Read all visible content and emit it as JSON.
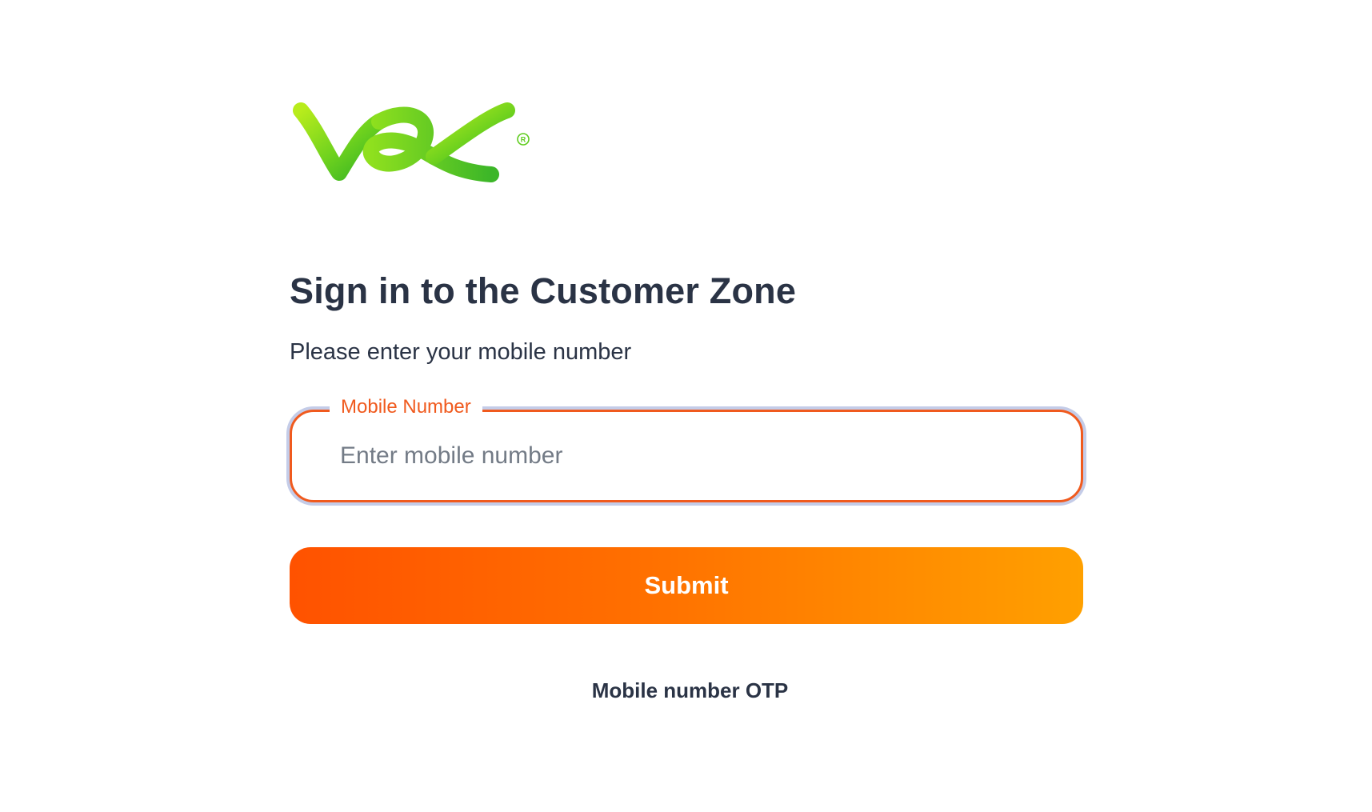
{
  "brand": {
    "logo_icon": "vox-logo-icon",
    "logo_color": "#78d61e",
    "accent_color": "#f05a1e"
  },
  "login": {
    "title": "Sign in to the Customer Zone",
    "subtitle": "Please enter your mobile number",
    "mobile_field": {
      "label": "Mobile Number",
      "placeholder": "Enter mobile number",
      "value": ""
    },
    "submit_label": "Submit",
    "otp_link_label": "Mobile number OTP"
  }
}
